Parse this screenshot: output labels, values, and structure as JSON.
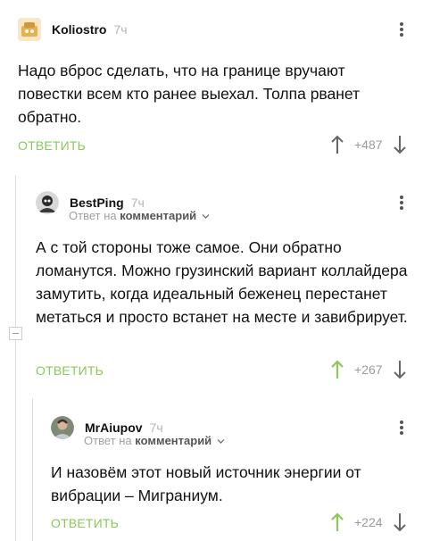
{
  "comments": [
    {
      "author": "Koliostro",
      "time": "7ч",
      "text": "Надо вброс сделать, что на границе вручают повестки всем кто ранее выехал. Толпа рванет обратно.",
      "reply_label": "ОТВЕТИТЬ",
      "score": "+487"
    },
    {
      "author": "BestPing",
      "time": "7ч",
      "reply_to_prefix": "Ответ на",
      "reply_to_link": "комментарий",
      "text": "А с той стороны тоже самое. Они обратно ломанутся. Можно грузинский вариант коллайдера замутить, когда идеальный беженец перестанет метаться и просто встанет на месте и завибрирует.",
      "reply_label": "ОТВЕТИТЬ",
      "score": "+267"
    },
    {
      "author": "MrAiupov",
      "time": "7ч",
      "reply_to_prefix": "Ответ на",
      "reply_to_link": "комментарий",
      "text": "И назовём этот новый источник энергии от вибрации – Миграниум.",
      "reply_label": "ОТВЕТИТЬ",
      "score": "+224"
    }
  ],
  "colors": {
    "accent_green": "#8ac858",
    "text": "#111111",
    "muted": "#a0a0a0"
  }
}
